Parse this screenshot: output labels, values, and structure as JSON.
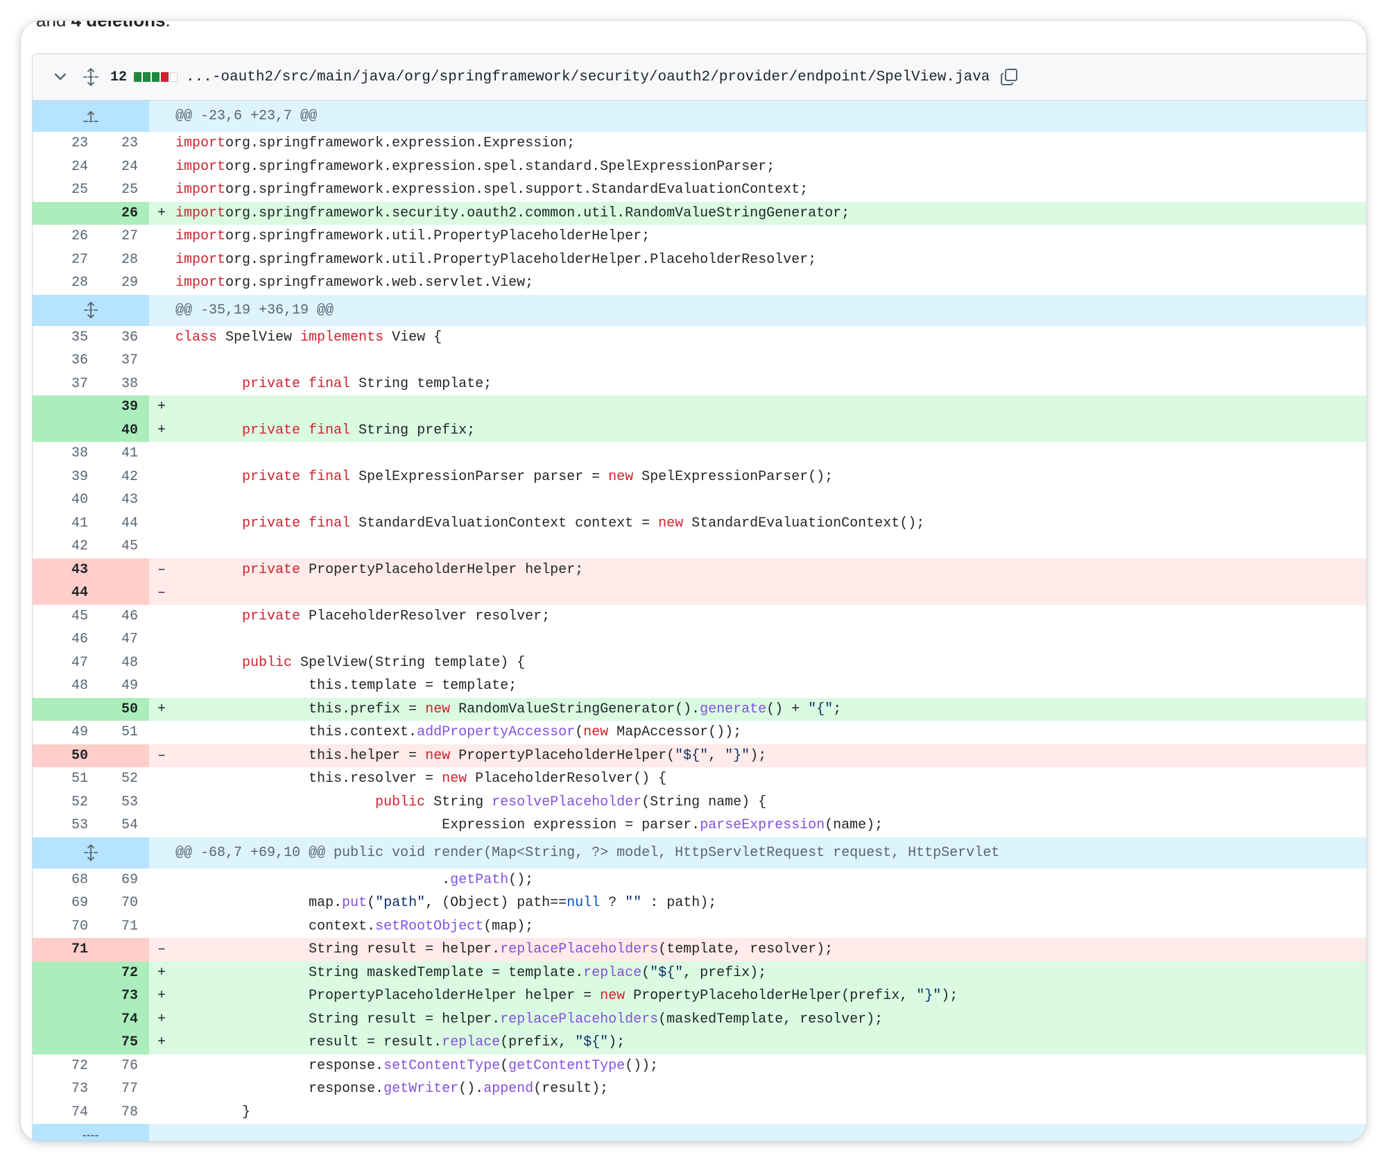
{
  "partial_text": {
    "prefix": "and ",
    "bold": "4 deletions",
    "suffix": "."
  },
  "file_header": {
    "changes": "12",
    "diffstat": [
      "add",
      "add",
      "add",
      "del",
      "neu"
    ],
    "path": "...-oauth2/src/main/java/org/springframework/security/oauth2/provider/endpoint/SpelView.java"
  },
  "colors": {
    "add_bg": "#dafbe1",
    "del_bg": "#ffebe9",
    "hunk_bg": "#ddf4ff",
    "keyword": "#cf222e",
    "method": "#8250df",
    "string": "#0a3069"
  },
  "icons": {
    "chevron": "chevron-down-icon",
    "expand": "unfold-icon",
    "copy": "copy-icon",
    "expand_up": "expand-up-icon"
  },
  "lines": [
    {
      "type": "hunk",
      "icon": "expand-up",
      "text": "@@ -23,6 +23,7 @@"
    },
    {
      "type": "ctx",
      "old": "23",
      "new": "23",
      "code": [
        [
          "kw",
          "import"
        ],
        [
          "",
          "org.springframework.expression.Expression;"
        ]
      ]
    },
    {
      "type": "ctx",
      "old": "24",
      "new": "24",
      "code": [
        [
          "kw",
          "import"
        ],
        [
          "",
          "org.springframework.expression.spel.standard.SpelExpressionParser;"
        ]
      ]
    },
    {
      "type": "ctx",
      "old": "25",
      "new": "25",
      "code": [
        [
          "kw",
          "import"
        ],
        [
          "",
          "org.springframework.expression.spel.support.StandardEvaluationContext;"
        ]
      ]
    },
    {
      "type": "add",
      "old": "",
      "new": "26",
      "code": [
        [
          "kw",
          "import"
        ],
        [
          "",
          "org.springframework.security.oauth2.common.util.RandomValueStringGenerator;"
        ]
      ]
    },
    {
      "type": "ctx",
      "old": "26",
      "new": "27",
      "code": [
        [
          "kw",
          "import"
        ],
        [
          "",
          "org.springframework.util.PropertyPlaceholderHelper;"
        ]
      ]
    },
    {
      "type": "ctx",
      "old": "27",
      "new": "28",
      "code": [
        [
          "kw",
          "import"
        ],
        [
          "",
          "org.springframework.util.PropertyPlaceholderHelper.PlaceholderResolver;"
        ]
      ]
    },
    {
      "type": "ctx",
      "old": "28",
      "new": "29",
      "code": [
        [
          "kw",
          "import"
        ],
        [
          "",
          "org.springframework.web.servlet.View;"
        ]
      ]
    },
    {
      "type": "hunk",
      "icon": "unfold",
      "text": "@@ -35,19 +36,19 @@"
    },
    {
      "type": "ctx",
      "old": "35",
      "new": "36",
      "code": [
        [
          "kw",
          "class"
        ],
        [
          "",
          " SpelView "
        ],
        [
          "kw",
          "implements"
        ],
        [
          "",
          " View {"
        ]
      ]
    },
    {
      "type": "ctx",
      "old": "36",
      "new": "37",
      "code": []
    },
    {
      "type": "ctx",
      "old": "37",
      "new": "38",
      "code": [
        [
          "",
          "        "
        ],
        [
          "kw",
          "private final"
        ],
        [
          "",
          " String template;"
        ]
      ]
    },
    {
      "type": "add",
      "old": "",
      "new": "39",
      "code": []
    },
    {
      "type": "add",
      "old": "",
      "new": "40",
      "code": [
        [
          "",
          "        "
        ],
        [
          "kw",
          "private final"
        ],
        [
          "",
          " String prefix;"
        ]
      ]
    },
    {
      "type": "ctx",
      "old": "38",
      "new": "41",
      "code": []
    },
    {
      "type": "ctx",
      "old": "39",
      "new": "42",
      "code": [
        [
          "",
          "        "
        ],
        [
          "kw",
          "private final"
        ],
        [
          "",
          " SpelExpressionParser parser = "
        ],
        [
          "kw",
          "new"
        ],
        [
          "",
          " SpelExpressionParser();"
        ]
      ]
    },
    {
      "type": "ctx",
      "old": "40",
      "new": "43",
      "code": []
    },
    {
      "type": "ctx",
      "old": "41",
      "new": "44",
      "code": [
        [
          "",
          "        "
        ],
        [
          "kw",
          "private final"
        ],
        [
          "",
          " StandardEvaluationContext context = "
        ],
        [
          "kw",
          "new"
        ],
        [
          "",
          " StandardEvaluationContext();"
        ]
      ]
    },
    {
      "type": "ctx",
      "old": "42",
      "new": "45",
      "code": []
    },
    {
      "type": "del",
      "old": "43",
      "new": "",
      "code": [
        [
          "",
          "        "
        ],
        [
          "kw",
          "private"
        ],
        [
          "",
          " PropertyPlaceholderHelper helper;"
        ]
      ]
    },
    {
      "type": "del",
      "old": "44",
      "new": "",
      "code": []
    },
    {
      "type": "ctx",
      "old": "45",
      "new": "46",
      "code": [
        [
          "",
          "        "
        ],
        [
          "kw",
          "private"
        ],
        [
          "",
          " PlaceholderResolver resolver;"
        ]
      ]
    },
    {
      "type": "ctx",
      "old": "46",
      "new": "47",
      "code": []
    },
    {
      "type": "ctx",
      "old": "47",
      "new": "48",
      "code": [
        [
          "",
          "        "
        ],
        [
          "kw",
          "public"
        ],
        [
          "",
          " SpelView(String template) {"
        ]
      ]
    },
    {
      "type": "ctx",
      "old": "48",
      "new": "49",
      "code": [
        [
          "",
          "                this.template = template;"
        ]
      ]
    },
    {
      "type": "add",
      "old": "",
      "new": "50",
      "code": [
        [
          "",
          "                this.prefix = "
        ],
        [
          "kw",
          "new"
        ],
        [
          "",
          " RandomValueStringGenerator()."
        ],
        [
          "fn",
          "generate"
        ],
        [
          "",
          "() + "
        ],
        [
          "str",
          "\"{\""
        ],
        [
          "",
          ";"
        ]
      ]
    },
    {
      "type": "ctx",
      "old": "49",
      "new": "51",
      "code": [
        [
          "",
          "                this.context."
        ],
        [
          "fn",
          "addPropertyAccessor"
        ],
        [
          "",
          "("
        ],
        [
          "kw",
          "new"
        ],
        [
          "",
          " MapAccessor());"
        ]
      ]
    },
    {
      "type": "del",
      "old": "50",
      "new": "",
      "code": [
        [
          "",
          "                this.helper = "
        ],
        [
          "kw",
          "new"
        ],
        [
          "",
          " PropertyPlaceholderHelper("
        ],
        [
          "str",
          "\"${\""
        ],
        [
          "",
          ", "
        ],
        [
          "str",
          "\"}\""
        ],
        [
          "",
          ");"
        ]
      ]
    },
    {
      "type": "ctx",
      "old": "51",
      "new": "52",
      "code": [
        [
          "",
          "                this.resolver = "
        ],
        [
          "kw",
          "new"
        ],
        [
          "",
          " PlaceholderResolver() {"
        ]
      ]
    },
    {
      "type": "ctx",
      "old": "52",
      "new": "53",
      "code": [
        [
          "",
          "                        "
        ],
        [
          "kw",
          "public"
        ],
        [
          "",
          " String "
        ],
        [
          "fn",
          "resolvePlaceholder"
        ],
        [
          "",
          "(String name) {"
        ]
      ]
    },
    {
      "type": "ctx",
      "old": "53",
      "new": "54",
      "code": [
        [
          "",
          "                                Expression expression = parser."
        ],
        [
          "fn",
          "parseExpression"
        ],
        [
          "",
          "(name);"
        ]
      ]
    },
    {
      "type": "hunk",
      "icon": "unfold",
      "text": "@@ -68,7 +69,10 @@ public void render(Map<String, ?> model, HttpServletRequest request, HttpServlet"
    },
    {
      "type": "ctx",
      "old": "68",
      "new": "69",
      "code": [
        [
          "",
          "                                ."
        ],
        [
          "fn",
          "getPath"
        ],
        [
          "",
          "();"
        ]
      ]
    },
    {
      "type": "ctx",
      "old": "69",
      "new": "70",
      "code": [
        [
          "",
          "                map."
        ],
        [
          "fn",
          "put"
        ],
        [
          "",
          "("
        ],
        [
          "str",
          "\"path\""
        ],
        [
          "",
          ", (Object) path=="
        ],
        [
          "cn",
          "null"
        ],
        [
          "",
          " ? "
        ],
        [
          "str",
          "\"\""
        ],
        [
          "",
          " : path);"
        ]
      ]
    },
    {
      "type": "ctx",
      "old": "70",
      "new": "71",
      "code": [
        [
          "",
          "                context."
        ],
        [
          "fn",
          "setRootObject"
        ],
        [
          "",
          "(map);"
        ]
      ]
    },
    {
      "type": "del",
      "old": "71",
      "new": "",
      "code": [
        [
          "",
          "                String result = helper."
        ],
        [
          "fn",
          "replacePlaceholders"
        ],
        [
          "",
          "(template, resolver);"
        ]
      ]
    },
    {
      "type": "add",
      "old": "",
      "new": "72",
      "code": [
        [
          "",
          "                String maskedTemplate = template."
        ],
        [
          "fn",
          "replace"
        ],
        [
          "",
          "("
        ],
        [
          "str",
          "\"${\""
        ],
        [
          "",
          ", prefix);"
        ]
      ]
    },
    {
      "type": "add",
      "old": "",
      "new": "73",
      "code": [
        [
          "",
          "                PropertyPlaceholderHelper helper = "
        ],
        [
          "kw",
          "new"
        ],
        [
          "",
          " PropertyPlaceholderHelper(prefix, "
        ],
        [
          "str",
          "\"}\""
        ],
        [
          "",
          ");"
        ]
      ]
    },
    {
      "type": "add",
      "old": "",
      "new": "74",
      "code": [
        [
          "",
          "                String result = helper."
        ],
        [
          "fn",
          "replacePlaceholders"
        ],
        [
          "",
          "(maskedTemplate, resolver);"
        ]
      ]
    },
    {
      "type": "add",
      "old": "",
      "new": "75",
      "code": [
        [
          "",
          "                result = result."
        ],
        [
          "fn",
          "replace"
        ],
        [
          "",
          "(prefix, "
        ],
        [
          "str",
          "\"${\""
        ],
        [
          "",
          ");"
        ]
      ]
    },
    {
      "type": "ctx",
      "old": "72",
      "new": "76",
      "code": [
        [
          "",
          "                response."
        ],
        [
          "fn",
          "setContentType"
        ],
        [
          "",
          "("
        ],
        [
          "fn",
          "getContentType"
        ],
        [
          "",
          "());"
        ]
      ]
    },
    {
      "type": "ctx",
      "old": "73",
      "new": "77",
      "code": [
        [
          "",
          "                response."
        ],
        [
          "fn",
          "getWriter"
        ],
        [
          "",
          "()."
        ],
        [
          "fn",
          "append"
        ],
        [
          "",
          "(result);"
        ]
      ]
    },
    {
      "type": "ctx",
      "old": "74",
      "new": "78",
      "code": [
        [
          "",
          "        }"
        ]
      ]
    },
    {
      "type": "hunk-last",
      "icon": "ellipsis",
      "text": ""
    }
  ]
}
